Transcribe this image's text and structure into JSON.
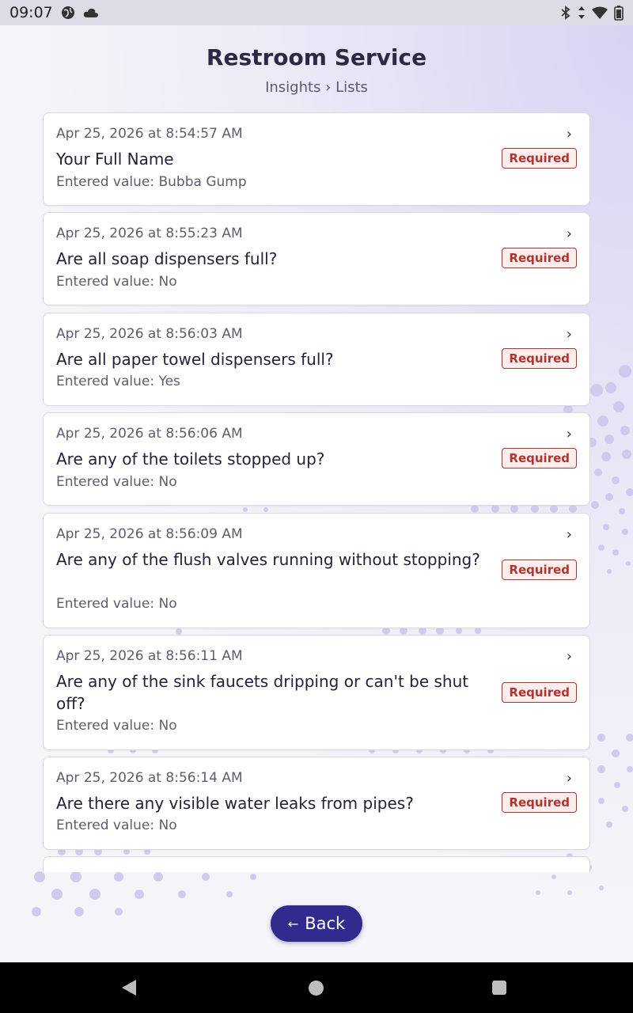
{
  "status_bar": {
    "time": "09:07"
  },
  "header": {
    "title": "Restroom Service",
    "breadcrumb": "Insights › Lists"
  },
  "items": [
    {
      "timestamp": "Apr 25, 2026 at 8:54:57 AM",
      "question": "Your Full Name",
      "value": "Entered value: Bubba Gump",
      "badge": "Required"
    },
    {
      "timestamp": "Apr 25, 2026 at 8:55:23 AM",
      "question": "Are all soap dispensers full?",
      "value": "Entered value: No",
      "badge": "Required"
    },
    {
      "timestamp": "Apr 25, 2026 at 8:56:03 AM",
      "question": "Are all paper towel dispensers full?",
      "value": "Entered value: Yes",
      "badge": "Required"
    },
    {
      "timestamp": "Apr 25, 2026 at 8:56:06 AM",
      "question": "Are any of the toilets stopped up?",
      "value": "Entered value: No",
      "badge": "Required"
    },
    {
      "timestamp": "Apr 25, 2026 at 8:56:09 AM",
      "question": "Are any of the flush valves running without stopping?",
      "value": "Entered value: No",
      "badge": "Required"
    },
    {
      "timestamp": "Apr 25, 2026 at 8:56:11 AM",
      "question": "Are any of the sink faucets dripping or can't be shut off?",
      "value": "Entered value: No",
      "badge": "Required"
    },
    {
      "timestamp": "Apr 25, 2026 at 8:56:14 AM",
      "question": "Are there any visible water leaks from pipes?",
      "value": "Entered value: No",
      "badge": "Required"
    }
  ],
  "chevron": "›",
  "back_button": {
    "arrow": "←",
    "label": "Back"
  },
  "colors": {
    "accent": "#322a8c",
    "badge": "#b3332e"
  }
}
